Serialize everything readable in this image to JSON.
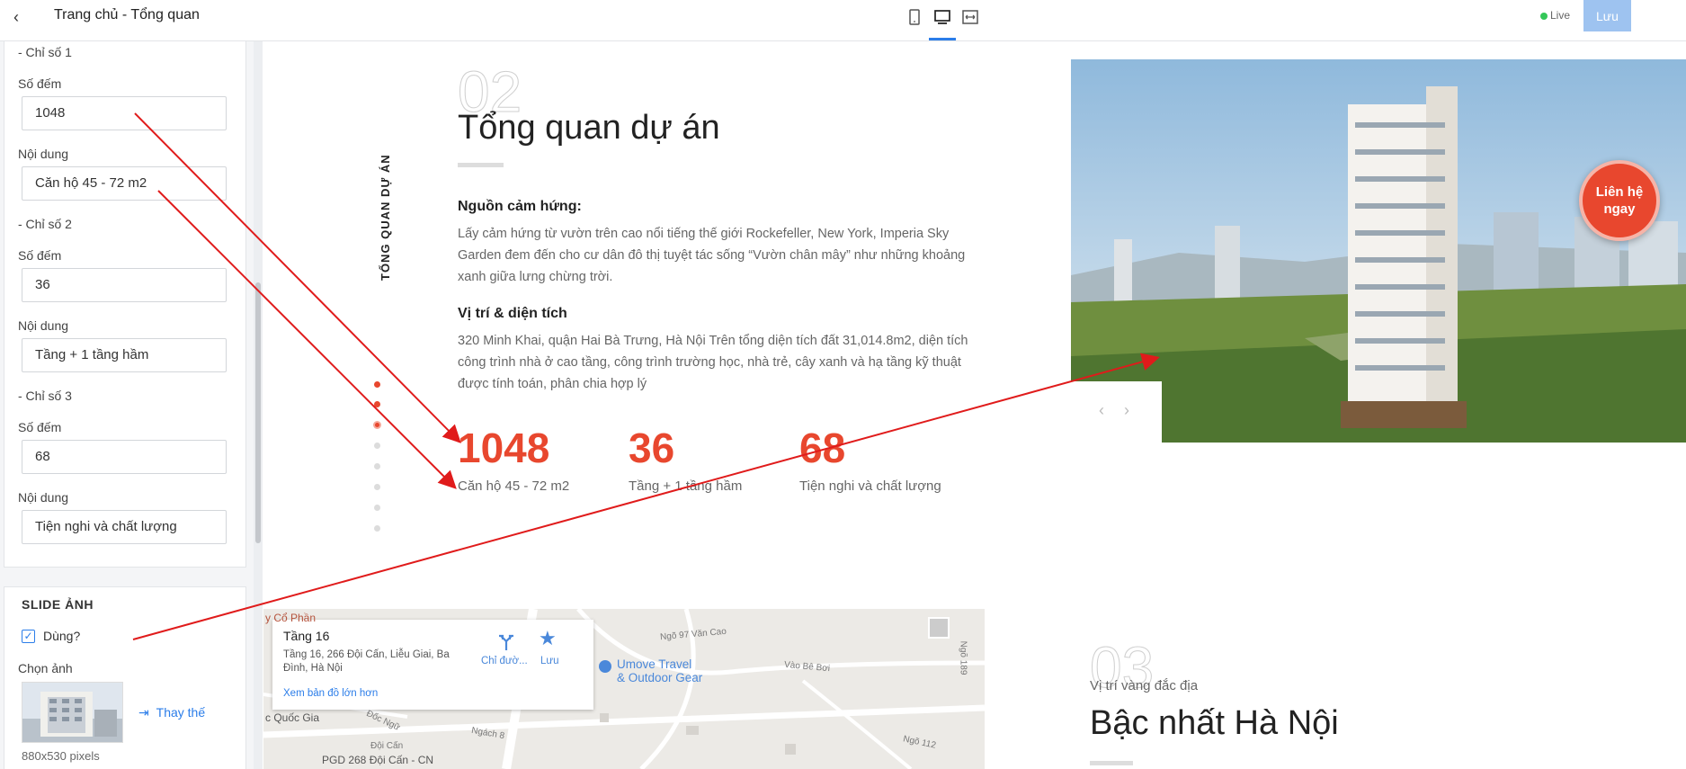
{
  "sidebar": {
    "title": "Trang chủ - Tổng quan",
    "stats": [
      {
        "group_label": "- Chỉ số 1",
        "count_label": "Số đếm",
        "count_value": "1048",
        "content_label": "Nội dung",
        "content_value": "Căn hộ 45 - 72 m2"
      },
      {
        "group_label": "- Chỉ số 2",
        "count_label": "Số đếm",
        "count_value": "36",
        "content_label": "Nội dung",
        "content_value": "Tầng + 1 tầng hầm"
      },
      {
        "group_label": "- Chỉ số 3",
        "count_label": "Số đếm",
        "count_value": "68",
        "content_label": "Nội dung",
        "content_value": "Tiện nghi và chất lượng"
      }
    ],
    "slide": {
      "section_title": "SLIDE ẢNH",
      "use_label": "Dùng?",
      "choose_label": "Chọn ảnh",
      "replace_label": "Thay thế",
      "dimensions": "880x530 pixels"
    }
  },
  "topbar": {
    "live_label": "Live",
    "save_label": "Lưu"
  },
  "preview": {
    "section_number": "02",
    "title": "Tổng quan dự án",
    "side_label": "TỔNG QUAN DỰ ÁN",
    "inspiration_heading": "Nguồn cảm hứng:",
    "inspiration_text": "Lấy cảm hứng từ vườn trên cao nổi tiếng thế giới Rockefeller, New York, Imperia Sky Garden đem đến cho cư dân đô thị tuyệt tác sống “Vườn chân mây” như những khoảng xanh giữa lưng chừng trời.",
    "location_heading": "Vị trí & diện tích",
    "location_text": "320 Minh Khai, quận Hai Bà Trưng, Hà Nội Trên tổng diện tích đất 31,014.8m2, diện tích công trình nhà ở cao tầng, công trình trường học, nhà trẻ, cây xanh và hạ tầng kỹ thuật được tính toán, phân chia hợp lý",
    "stats": [
      {
        "number": "1048",
        "label": "Căn hộ 45 - 72 m2"
      },
      {
        "number": "36",
        "label": "Tầng + 1 tầng hầm"
      },
      {
        "number": "68",
        "label": "Tiện nghi và chất lượng"
      }
    ],
    "cta_line1": "Liên hệ",
    "cta_line2": "ngay",
    "map": {
      "place_name": "Tầng 16",
      "address": "Tầng 16, 266 Đội Cấn, Liễu Giai, Ba Đình, Hà Nội",
      "directions_label": "Chỉ đườ...",
      "save_label": "Lưu",
      "view_larger": "Xem bản đồ lớn hơn",
      "poi_name_1": "Umove Travel",
      "poi_name_2": "& Outdoor Gear",
      "street_1": "Ngõ 97 Văn Cao",
      "street_2": "Vào Bê Bơi",
      "street_3": "Ngõ 112",
      "street_4": "Ngách 8",
      "street_5": "Đốc Ngữ",
      "street_6": "Đội Cấn",
      "street_7": "Ngõ 189",
      "place_1": "y Cổ Phần",
      "place_2": "c Quốc Gia",
      "place_3": "PGD 268 Đội Cấn - CN"
    },
    "next_section_number": "03",
    "next_kicker": "Vị trí vàng đắc địa",
    "next_title": "Bậc nhất Hà Nội"
  }
}
